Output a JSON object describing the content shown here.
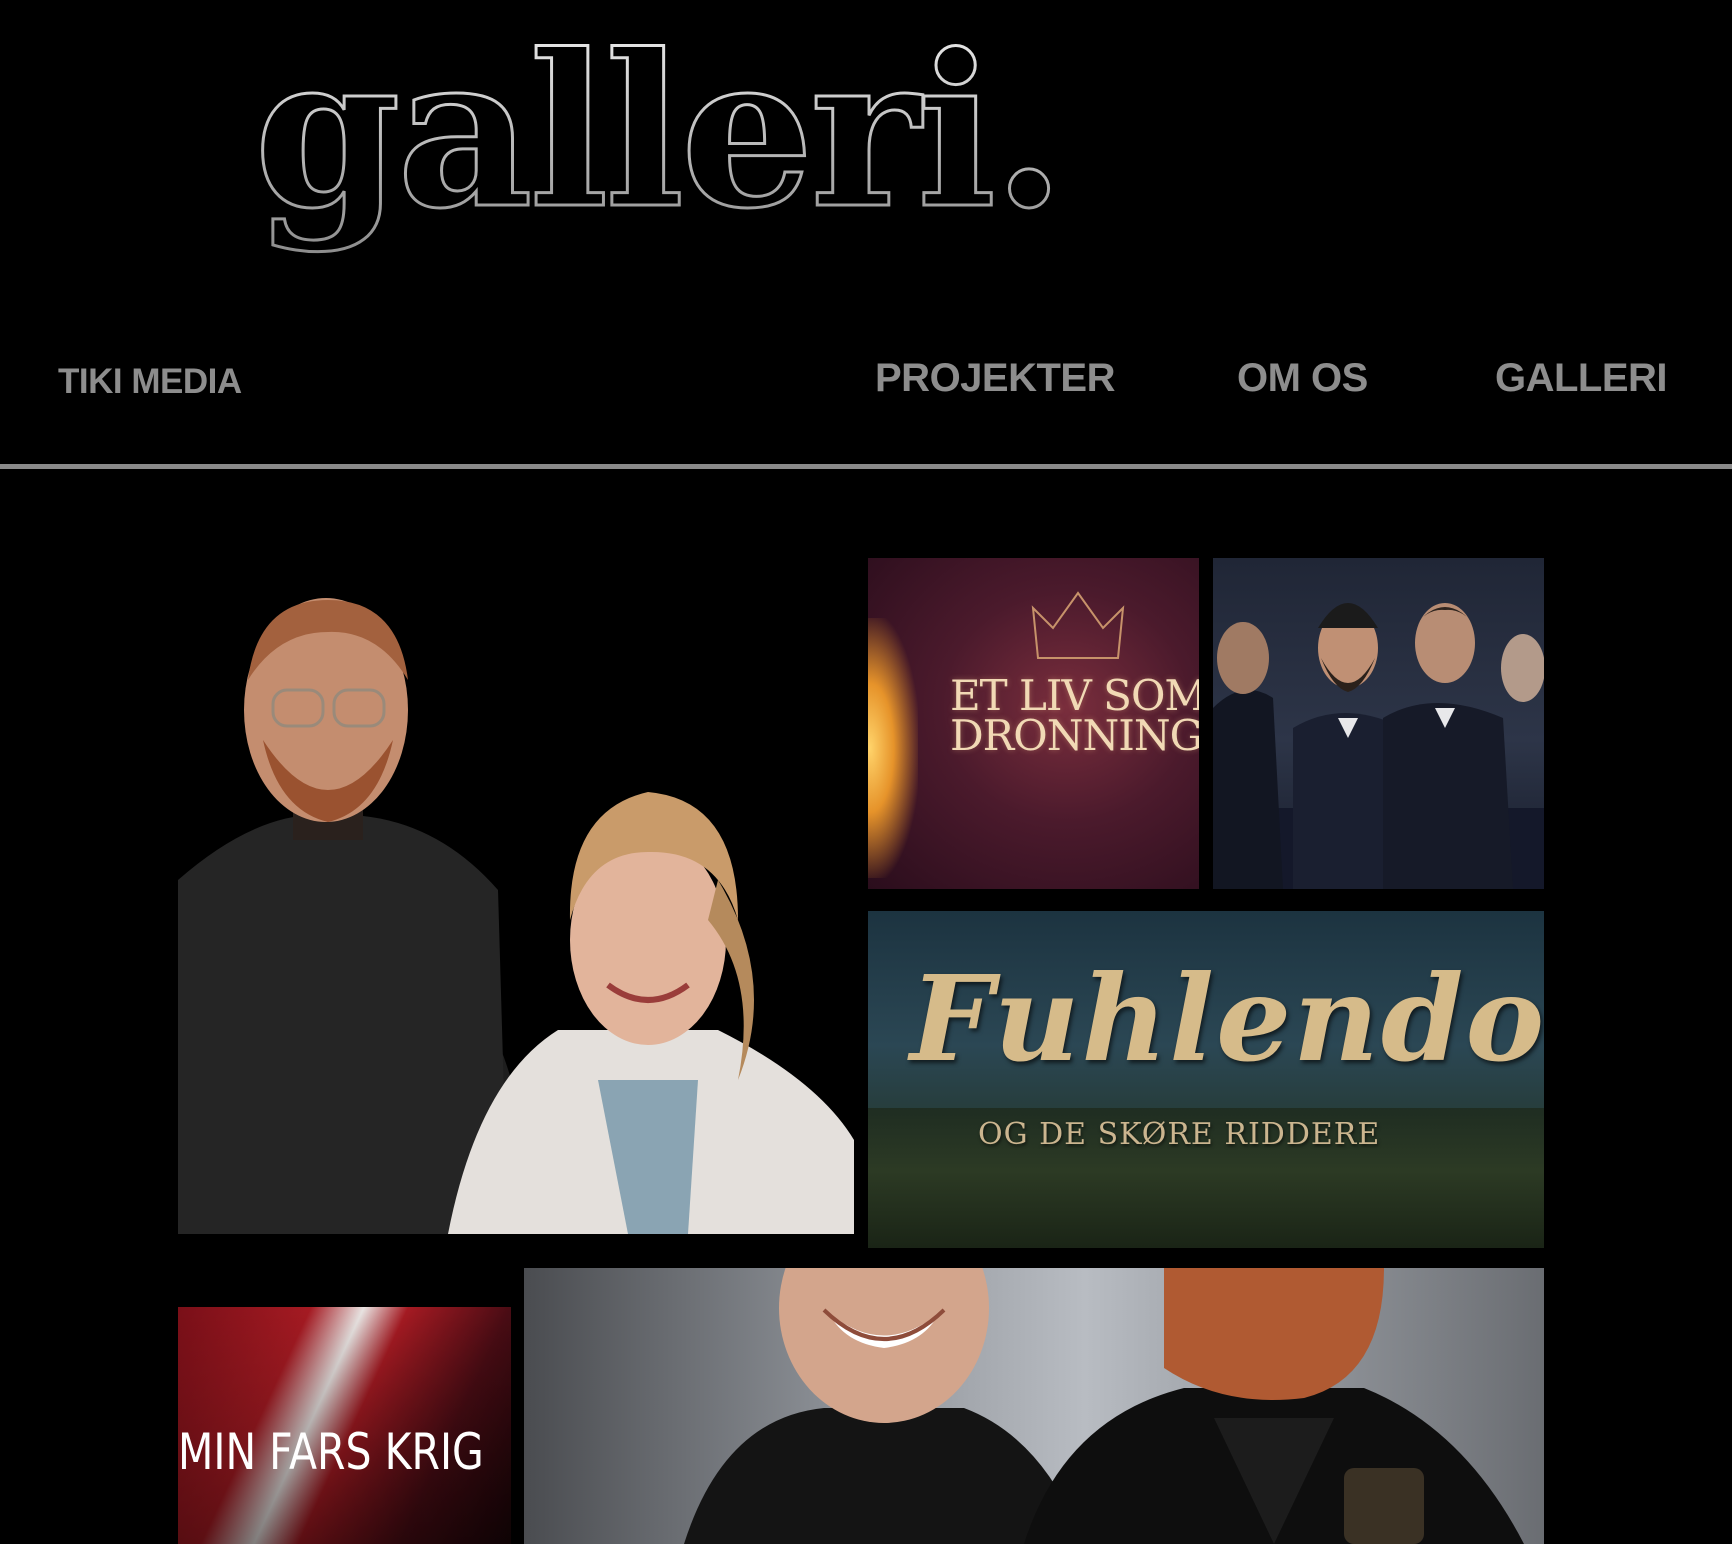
{
  "logo": {
    "text": "galleri."
  },
  "nav": {
    "brand": "TIKI MEDIA",
    "links": [
      {
        "label": "PROJEKTER"
      },
      {
        "label": "OM OS"
      },
      {
        "label": "GALLERI"
      }
    ]
  },
  "gallery": {
    "tiles": [
      {
        "title": ""
      },
      {
        "title_line1": "ET LIV SOM",
        "title_line2": "DRONNING"
      },
      {
        "title": ""
      },
      {
        "title": "Fuhlendorff",
        "subtitle": "OG DE SKØRE RIDDERE"
      },
      {
        "title": "MIN FARS KRIG"
      },
      {
        "title": ""
      }
    ]
  },
  "colors": {
    "background": "#000000",
    "nav_text": "#8d8d8d",
    "divider": "#8a8a8a",
    "logo_outline": "#d8d8d8"
  }
}
